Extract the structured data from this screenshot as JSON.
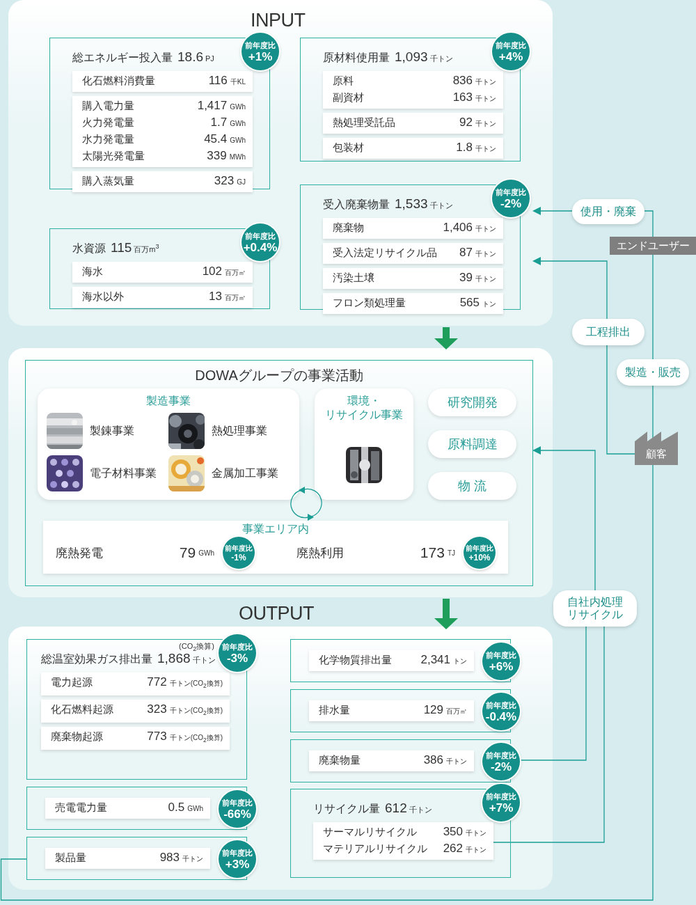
{
  "input": {
    "title": "INPUT",
    "cards": [
      {
        "title": "総エネルギー投入量",
        "value": "18.6",
        "unit": "PJ",
        "change": {
          "label": "前年度比",
          "value": "+1%"
        },
        "groups": [
          [
            {
              "label": "化石燃料消費量",
              "value": "116",
              "unit": "千KL"
            }
          ],
          [
            {
              "label": "購入電力量",
              "value": "1,417",
              "unit": "GWh"
            },
            {
              "label": "火力発電量",
              "value": "1.7",
              "unit": "GWh"
            },
            {
              "label": "水力発電量",
              "value": "45.4",
              "unit": "GWh"
            },
            {
              "label": "太陽光発電量",
              "value": "339",
              "unit": "MWh"
            }
          ],
          [
            {
              "label": "購入蒸気量",
              "value": "323",
              "unit": "GJ"
            }
          ]
        ]
      },
      {
        "title": "水資源",
        "value": "115",
        "unit": "百万m$^{3}$",
        "change": {
          "label": "前年度比",
          "value": "+0.4%"
        },
        "groups": [
          [
            {
              "label": "海水",
              "value": "102",
              "unit": "百万㎥"
            }
          ],
          [
            {
              "label": "海水以外",
              "value": "13",
              "unit": "百万㎥"
            }
          ]
        ]
      },
      {
        "title": "原材料使用量",
        "value": "1,093",
        "unit": "千トン",
        "change": {
          "label": "前年度比",
          "value": "+4%"
        },
        "groups": [
          [
            {
              "label": "原料",
              "value": "836",
              "unit": "千トン"
            },
            {
              "label": "副資材",
              "value": "163",
              "unit": "千トン"
            }
          ],
          [
            {
              "label": "熱処理受託品",
              "value": "92",
              "unit": "千トン"
            }
          ],
          [
            {
              "label": "包装材",
              "value": "1.8",
              "unit": "千トン"
            }
          ]
        ]
      },
      {
        "title": "受入廃棄物量",
        "value": "1,533",
        "unit": "千トン",
        "change": {
          "label": "前年度比",
          "value": "-2%"
        },
        "groups": [
          [
            {
              "label": "廃棄物",
              "value": "1,406",
              "unit": "千トン"
            }
          ],
          [
            {
              "label": "受入法定リサイクル品",
              "value": "87",
              "unit": "千トン"
            }
          ],
          [
            {
              "label": "汚染土壌",
              "value": "39",
              "unit": "千トン"
            }
          ],
          [
            {
              "label": "フロン類処理量",
              "value": "565",
              "unit": "トン"
            }
          ]
        ]
      }
    ]
  },
  "business": {
    "title": "DOWAグループの事業活動",
    "manufacturing": {
      "heading": "製造事業",
      "items": [
        {
          "label": "製錬事業"
        },
        {
          "label": "熱処理事業"
        },
        {
          "label": "電子材料事業"
        },
        {
          "label": "金属加工事業"
        }
      ]
    },
    "environment": {
      "heading_lines": [
        "環境・",
        "リサイクル事業"
      ]
    },
    "functions": [
      {
        "label": "研究開発"
      },
      {
        "label": "原料調達"
      },
      {
        "label": "物 流"
      }
    ],
    "area": {
      "heading": "事業エリア内",
      "items": [
        {
          "label": "廃熱発電",
          "value": "79",
          "unit": "GWh",
          "change": {
            "label": "前年度比",
            "value": "-1%"
          }
        },
        {
          "label": "廃熱利用",
          "value": "173",
          "unit": "TJ",
          "change": {
            "label": "前年度比",
            "value": "+10%"
          }
        }
      ]
    }
  },
  "output": {
    "title": "OUTPUT",
    "cards": [
      {
        "note": "(CO$_{2}$換算)",
        "title": "総温室効果ガス排出量",
        "value": "1,868",
        "unit": "千トン",
        "change": {
          "label": "前年度比",
          "value": "-3%"
        },
        "groups": [
          [
            {
              "label": "電力起源",
              "value": "772",
              "unit": "千トン(CO$_{2}$換算)"
            }
          ],
          [
            {
              "label": "化石燃料起源",
              "value": "323",
              "unit": "千トン(CO$_{2}$換算)"
            }
          ],
          [
            {
              "label": "廃棄物起源",
              "value": "773",
              "unit": "千トン(CO$_{2}$換算)"
            }
          ]
        ]
      },
      {
        "change": {
          "label": "前年度比",
          "value": "+6%"
        },
        "groups": [
          [
            {
              "label": "化学物質排出量",
              "value": "2,341",
              "unit": "トン"
            }
          ]
        ]
      },
      {
        "change": {
          "label": "前年度比",
          "value": "-0.4%"
        },
        "groups": [
          [
            {
              "label": "排水量",
              "value": "129",
              "unit": "百万㎥"
            }
          ]
        ]
      },
      {
        "change": {
          "label": "前年度比",
          "value": "-2%"
        },
        "groups": [
          [
            {
              "label": "廃棄物量",
              "value": "386",
              "unit": "千トン"
            }
          ]
        ]
      },
      {
        "change": {
          "label": "前年度比",
          "value": "-66%"
        },
        "groups": [
          [
            {
              "label": "売電電力量",
              "value": "0.5",
              "unit": "GWh"
            }
          ]
        ]
      },
      {
        "title": "リサイクル量",
        "value": "612",
        "unit": "千トン",
        "change": {
          "label": "前年度比",
          "value": "+7%"
        },
        "groups": [
          [
            {
              "label": "サーマルリサイクル",
              "value": "350",
              "unit": "千トン"
            },
            {
              "label": "マテリアルリサイクル",
              "value": "262",
              "unit": "千トン"
            }
          ]
        ]
      },
      {
        "change": {
          "label": "前年度比",
          "value": "+3%"
        },
        "groups": [
          [
            {
              "label": "製品量",
              "value": "983",
              "unit": "千トン"
            }
          ]
        ]
      }
    ]
  },
  "flow": {
    "labels": [
      {
        "kind": "pill",
        "lines": [
          "使用・廃棄"
        ]
      },
      {
        "kind": "tag",
        "lines": [
          "エンドユーザー"
        ]
      },
      {
        "kind": "pill",
        "lines": [
          "工程排出"
        ]
      },
      {
        "kind": "pill",
        "lines": [
          "製造・販売"
        ]
      },
      {
        "kind": "factory",
        "lines": [
          "顧客"
        ]
      },
      {
        "kind": "pill",
        "lines": [
          "自社内処理",
          "リサイクル"
        ]
      }
    ]
  }
}
